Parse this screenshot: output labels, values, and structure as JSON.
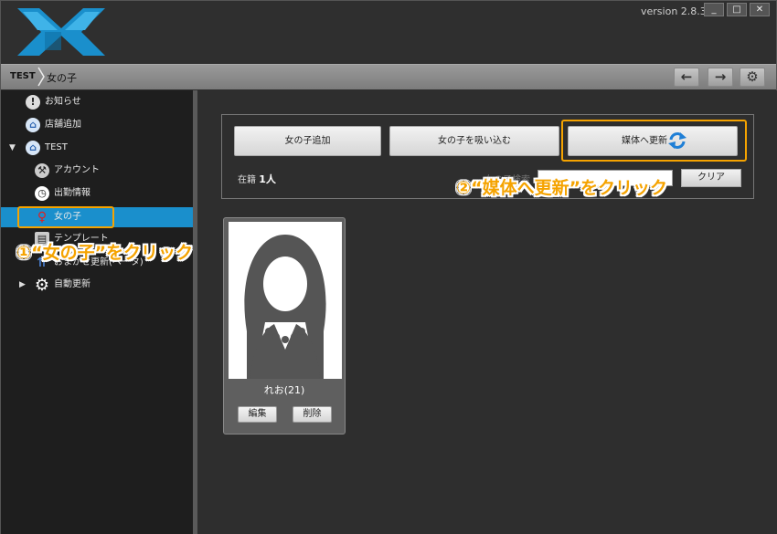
{
  "window": {
    "version": "version 2.8.3",
    "controls": [
      "_",
      "□",
      "✕"
    ]
  },
  "breadcrumb": {
    "root": "TEST",
    "page": "女の子"
  },
  "nav": {
    "back": "←",
    "forward": "→",
    "settings": "⚙"
  },
  "sidebar": {
    "items": [
      {
        "label": "お知らせ",
        "icon": "exclamation-icon"
      },
      {
        "label": "店舗追加",
        "icon": "home-add-icon"
      },
      {
        "label": "TEST",
        "icon": "home-icon",
        "expanded": true
      },
      {
        "label": "アカウント",
        "icon": "wrench-icon"
      },
      {
        "label": "出勤情報",
        "icon": "clock-icon"
      },
      {
        "label": "女の子",
        "icon": "female-icon",
        "selected": true
      },
      {
        "label": "テンプレート",
        "icon": "document-icon"
      },
      {
        "label": "おまかせ更新(ベータ)",
        "icon": "upload-icon"
      },
      {
        "label": "自動更新",
        "icon": "gear-icon",
        "expanded": false
      }
    ]
  },
  "actions": {
    "add_girl": "女の子追加",
    "import_girl": "女の子を吸い込む",
    "update_media": "媒体へ更新"
  },
  "list": {
    "count_prefix": "在籍",
    "count_value": "1人",
    "search_label": "女の子検索",
    "clear": "クリア"
  },
  "girls": [
    {
      "name": "れお(21)",
      "edit": "編集",
      "delete": "削除"
    }
  ],
  "annotations": {
    "step1": "①“女の子”をクリック",
    "step2": "②“媒体へ更新”をクリック"
  },
  "colors": {
    "accent_blue": "#1a8fcc",
    "annotation_orange": "#f5a300"
  }
}
